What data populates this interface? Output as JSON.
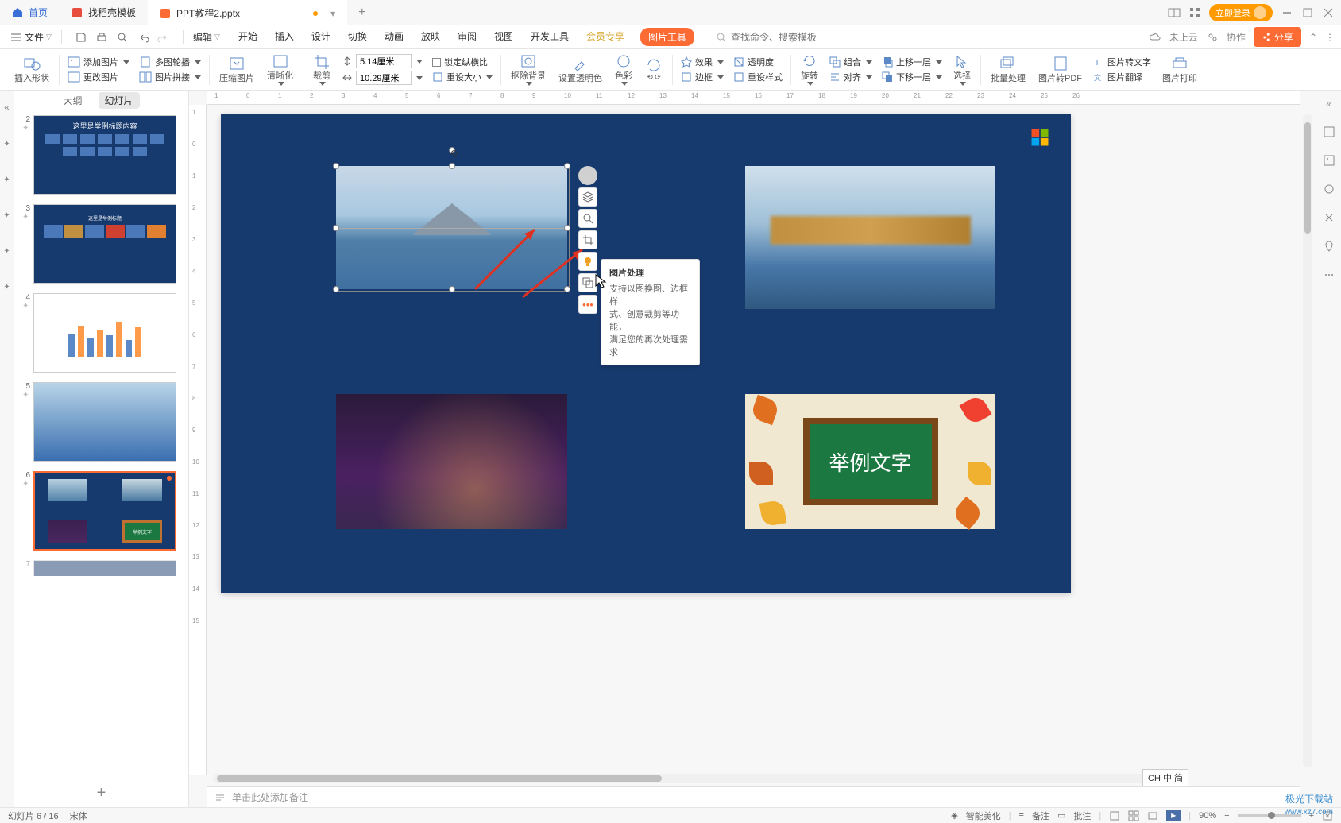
{
  "tabbar": {
    "home": "首页",
    "template_tab": "找稻壳模板",
    "file_tab": "PPT教程2.pptx",
    "login": "立即登录"
  },
  "menubar": {
    "file": "文件",
    "edit": "编辑",
    "tabs": [
      "开始",
      "插入",
      "设计",
      "切换",
      "动画",
      "放映",
      "审阅",
      "视图",
      "开发工具",
      "会员专享"
    ],
    "pic_tools": "图片工具",
    "search_icon_label": "查找命令",
    "search_ph": "查找命令、搜索模板",
    "cloud": "未上云",
    "coop": "协作",
    "share": "分享"
  },
  "ribbon": {
    "insert_shape": "插入形状",
    "add_pic": "添加图片",
    "multi_outline": "多图轮播",
    "change_pic": "更改图片",
    "pic_join": "图片拼接",
    "compress": "压缩图片",
    "clarity": "清晰化",
    "crop": "裁剪",
    "h_val": "5.14厘米",
    "w_val": "10.29厘米",
    "lock_ratio": "锁定纵横比",
    "reset_size": "重设大小",
    "remove_bg": "抠除背景",
    "set_trans": "设置透明色",
    "color": "色彩",
    "effect": "效果",
    "border": "边框",
    "trans": "透明度",
    "reset_style": "重设样式",
    "rotate": "旋转",
    "combine": "组合",
    "align": "对齐",
    "up_layer": "上移一层",
    "down_layer": "下移一层",
    "select": "选择",
    "batch": "批量处理",
    "pic2pdf": "图片转PDF",
    "pic2text": "图片转文字",
    "pic_trans": "图片翻译",
    "pic_print": "图片打印"
  },
  "panel": {
    "outline": "大纲",
    "slides": "幻灯片"
  },
  "thumbs": {
    "t2_title": "这里是举例标题内容",
    "numbers": [
      "2",
      "3",
      "4",
      "5",
      "6",
      "7"
    ],
    "chalk": "举例文字"
  },
  "tooltip": {
    "title": "图片处理",
    "line1": "支持以图换图、边框样",
    "line2": "式、创意裁剪等功能，",
    "line3": "满足您的再次处理需求"
  },
  "notes": {
    "placeholder": "单击此处添加备注"
  },
  "status": {
    "page": "幻灯片 6 / 16",
    "font": "宋体",
    "beautify": "智能美化",
    "notes": "备注",
    "comment": "批注",
    "zoom": "90%"
  },
  "ime": "CH 中 简",
  "watermark": "极光下载站",
  "watermark2": "www.xz7.com"
}
